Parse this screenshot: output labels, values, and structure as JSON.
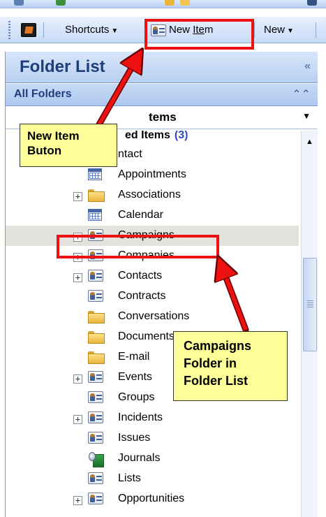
{
  "toolbar": {
    "shortcuts_label": "Shortcuts",
    "new_item_pre": "New ",
    "new_item_underlined": "Ite",
    "new_item_post": "m",
    "new_label": "New"
  },
  "pane": {
    "title": "Folder List",
    "collapse_glyph": "«",
    "all_folders_label": "All Folders",
    "all_folders_glyph": "⌃⌃",
    "dropdown_text": "tems",
    "dropdown_arrow": "▼"
  },
  "tree": {
    "root_label": "ed Items",
    "root_count": "(3)",
    "items": [
      {
        "label": "ntact",
        "icon": "none",
        "expand": false
      },
      {
        "label": "Appointments",
        "icon": "calendar-icon",
        "expand": false
      },
      {
        "label": "Associations",
        "icon": "folder-icon",
        "expand": true
      },
      {
        "label": "Calendar",
        "icon": "calendar-icon",
        "expand": false
      },
      {
        "label": "Campaigns",
        "icon": "form-icon",
        "expand": true,
        "selected": true
      },
      {
        "label": "Companies",
        "icon": "form-icon",
        "expand": true
      },
      {
        "label": "Contacts",
        "icon": "form-icon",
        "expand": true
      },
      {
        "label": "Contracts",
        "icon": "form-icon",
        "expand": false
      },
      {
        "label": "Conversations",
        "icon": "folder-icon",
        "expand": false
      },
      {
        "label": "Documents",
        "icon": "folder-icon",
        "expand": false
      },
      {
        "label": "E-mail",
        "icon": "folder-icon",
        "expand": false
      },
      {
        "label": "Events",
        "icon": "form-icon",
        "expand": true
      },
      {
        "label": "Groups",
        "icon": "form-icon",
        "expand": false
      },
      {
        "label": "Incidents",
        "icon": "form-icon",
        "expand": true
      },
      {
        "label": "Issues",
        "icon": "form-icon",
        "expand": false
      },
      {
        "label": "Journals",
        "icon": "journal-icon",
        "expand": false
      },
      {
        "label": "Lists",
        "icon": "form-icon",
        "expand": false
      },
      {
        "label": "Opportunities",
        "icon": "form-icon",
        "expand": true
      }
    ]
  },
  "annotations": {
    "callout1_line1": "New Item",
    "callout1_line2": "Buton",
    "callout2_line1": "Campaigns",
    "callout2_line2": "Folder in",
    "callout2_line3": "Folder List",
    "highlight_color": "#ee1111",
    "callout_bg": "#ffff99"
  }
}
